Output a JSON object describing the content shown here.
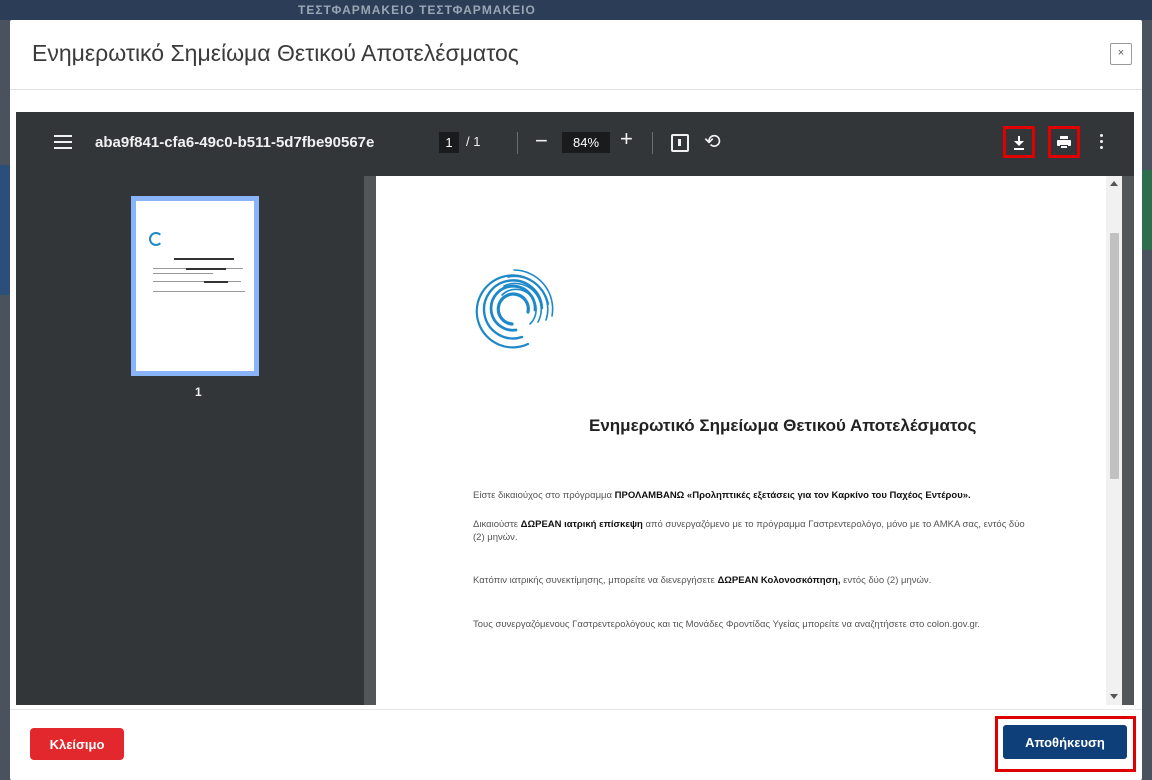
{
  "background": {
    "header_text": "ΤΕΣΤΦΑΡΜΑΚΕΙΟ ΤΕΣΤΦΑΡΜΑΚΕΙΟ"
  },
  "modal": {
    "title": "Ενημερωτικό Σημείωμα Θετικού Αποτελέσματος",
    "close_glyph": "×"
  },
  "viewer": {
    "filename": "aba9f841-cfa6-49c0-b511-5d7fbe90567e",
    "current_page": "1",
    "page_separator": "/ 1",
    "minus": "−",
    "zoom": "84%",
    "plus": "+",
    "rotate_glyph": "⟲",
    "thumbnail_page_number": "1",
    "icons": {
      "menu": "menu-icon",
      "fit": "fit-page-icon",
      "rotate": "rotate-icon",
      "download": "download-icon",
      "print": "print-icon",
      "more": "more-vertical-icon"
    }
  },
  "document": {
    "title": "Ενημερωτικό Σημείωμα Θετικού Αποτελέσματος",
    "p1_pre": "Είστε δικαιούχος στο πρόγραμμα ",
    "p1_bold": "ΠΡΟΛΑΜΒΑΝΩ «Προληπτικές εξετάσεις για τον Καρκίνο του Παχέος Εντέρου».",
    "p2_pre": "Δικαιούστε ",
    "p2_bold": "ΔΩΡΕΑΝ ιατρική επίσκεψη",
    "p2_post": " από συνεργαζόμενο με το πρόγραμμα Γαστρεντερολόγο, μόνο με το ΑΜΚΑ σας, εντός δύο (2) μηνών.",
    "p3_pre": "Κατόπιν ιατρικής συνεκτίμησης, μπορείτε να διενεργήσετε ",
    "p3_bold": "ΔΩΡΕΑΝ Κολονοσκόπηση,",
    "p3_post": " εντός δύο (2) μηνών.",
    "p4": "Τους συνεργαζόμενους Γαστρεντερολόγους και τις Μονάδες Φροντίδας Υγείας μπορείτε να αναζητήσετε στο colon.gov.gr."
  },
  "footer": {
    "close_label": "Κλείσιμο",
    "save_label": "Αποθήκευση"
  },
  "colors": {
    "close_button": "#e2282c",
    "save_button": "#0e3f78",
    "highlight": "#e00000",
    "toolbar": "#323639",
    "thumb_border": "#8ab4f8"
  }
}
